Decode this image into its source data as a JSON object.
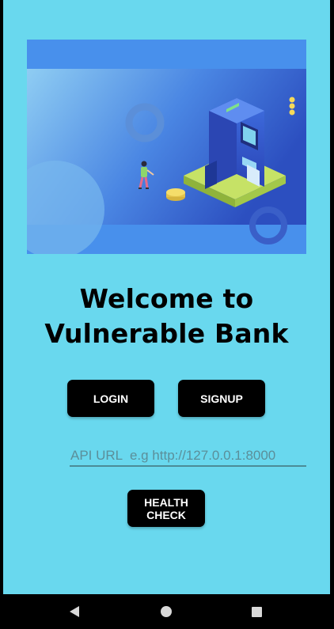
{
  "welcome": {
    "line1": "Welcome to",
    "line2": "Vulnerable Bank"
  },
  "buttons": {
    "login_label": "LOGIN",
    "signup_label": "SIGNUP",
    "health_check_label": "HEALTH\nCHECK"
  },
  "api_url": {
    "value": "",
    "placeholder": "API URL  e.g http://127.0.0.1:8000"
  },
  "hero": {
    "image": "atm-illustration"
  },
  "navbar": {
    "back_icon": "back-icon",
    "home_icon": "home-icon",
    "recents_icon": "recents-icon"
  },
  "colors": {
    "background": "#69d8ee",
    "hero_band": "#4890ec",
    "button": "#000000"
  }
}
